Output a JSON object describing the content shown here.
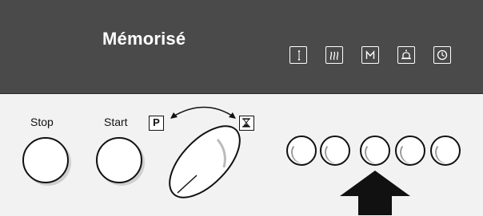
{
  "display": {
    "text": "Mémorisé",
    "indicators": [
      {
        "name": "temperature-adjust-icon",
        "glyph": "↕"
      },
      {
        "name": "steam-icon",
        "glyph": "§"
      },
      {
        "name": "memory-icon",
        "glyph": "M"
      },
      {
        "name": "alarm-bell-icon",
        "glyph": "🔔"
      },
      {
        "name": "clock-icon",
        "glyph": "◷"
      }
    ]
  },
  "controls": {
    "stop_label": "Stop",
    "start_label": "Start",
    "program_mode_label": "P",
    "timer_mode_icon": "hourglass-icon"
  },
  "selection_buttons": {
    "count": 5,
    "highlighted_index": 3
  },
  "colors": {
    "display_bg": "#4a4a4a",
    "panel_bg": "#f2f2f2",
    "outline": "#111111"
  }
}
